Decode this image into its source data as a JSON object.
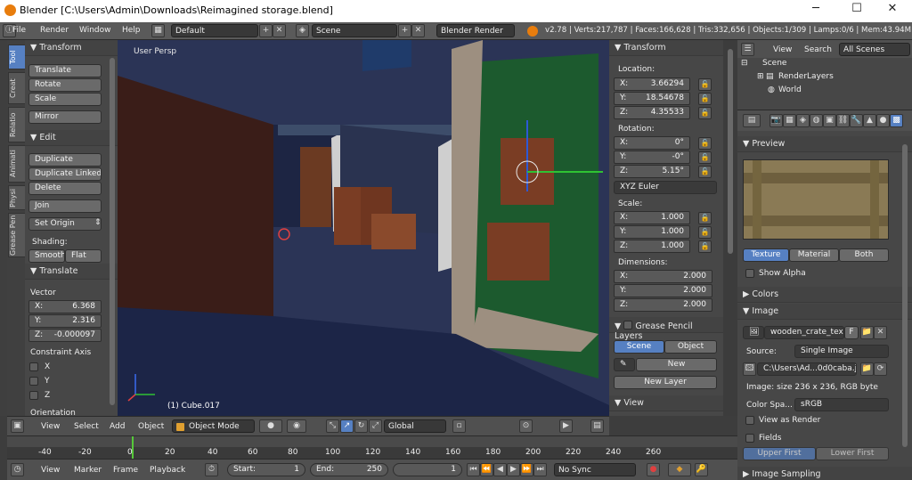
{
  "window": {
    "title": "Blender [C:\\Users\\Admin\\Downloads\\Reimagined storage.blend]",
    "min": "─",
    "max": "☐",
    "close": "✕"
  },
  "menu": {
    "items": [
      "File",
      "Render",
      "Window",
      "Help"
    ],
    "layout": "Default",
    "scene": "Scene",
    "engine": "Blender Render",
    "stats": "v2.78 | Verts:217,787 | Faces:166,628 | Tris:332,656 | Objects:1/309 | Lamps:0/6 | Mem:43.94M"
  },
  "tabs": [
    "Tool",
    "Creat",
    "Relatio",
    "Animati",
    "Physi",
    "Grease Pen"
  ],
  "tools": {
    "transform_title": "Transform",
    "translate": "Translate",
    "rotate": "Rotate",
    "scale": "Scale",
    "mirror": "Mirror",
    "edit_title": "Edit",
    "duplicate": "Duplicate",
    "duplicate_linked": "Duplicate Linked",
    "delete": "Delete",
    "join": "Join",
    "set_origin": "Set Origin",
    "shading": "Shading:",
    "smooth": "Smooth",
    "flat": "Flat"
  },
  "operator": {
    "title": "Translate",
    "vector": "Vector",
    "x_label": "X:",
    "x": "6.368",
    "y_label": "Y:",
    "y": "2.316",
    "z_label": "Z:",
    "z": "-0.000097",
    "constraint": "Constraint Axis",
    "cx": "X",
    "cy": "Y",
    "cz": "Z",
    "orientation": "Orientation"
  },
  "viewport": {
    "persp": "User Persp",
    "object": "(1) Cube.017",
    "toolbar": {
      "view": "View",
      "select": "Select",
      "add": "Add",
      "object": "Object",
      "mode": "Object Mode",
      "orientation": "Global"
    }
  },
  "npanel": {
    "transform": "Transform",
    "location": "Location:",
    "loc": [
      {
        "l": "X:",
        "v": "3.66294"
      },
      {
        "l": "Y:",
        "v": "18.54678"
      },
      {
        "l": "Z:",
        "v": "4.35533"
      }
    ],
    "rotation": "Rotation:",
    "rot": [
      {
        "l": "X:",
        "v": "0°"
      },
      {
        "l": "Y:",
        "v": "-0°"
      },
      {
        "l": "Z:",
        "v": "5.15°"
      }
    ],
    "euler": "XYZ Euler",
    "scale": "Scale:",
    "scl": [
      {
        "l": "X:",
        "v": "1.000"
      },
      {
        "l": "Y:",
        "v": "1.000"
      },
      {
        "l": "Z:",
        "v": "1.000"
      }
    ],
    "dimensions": "Dimensions:",
    "dim": [
      {
        "l": "X:",
        "v": "2.000"
      },
      {
        "l": "Y:",
        "v": "2.000"
      },
      {
        "l": "Z:",
        "v": "2.000"
      }
    ],
    "gp": "Grease Pencil Layers",
    "gp_scene": "Scene",
    "gp_object": "Object",
    "gp_new": "New",
    "gp_new_layer": "New Layer",
    "view": "View"
  },
  "outliner": {
    "view": "View",
    "search": "Search",
    "all": "All Scenes",
    "scene": "Scene",
    "render_layers": "RenderLayers",
    "world": "World"
  },
  "props": {
    "preview": "Preview",
    "texture": "Texture",
    "material": "Material",
    "both": "Both",
    "show_alpha": "Show Alpha",
    "colors": "Colors",
    "image": "Image",
    "image_name": "wooden_crate_tex...",
    "f": "F",
    "source_label": "Source:",
    "source": "Single Image",
    "path": "C:\\Users\\Ad...0d0caba.jpg",
    "size": "Image: size 236 x 236, RGB byte",
    "color_space_label": "Color Spa...",
    "color_space": "sRGB",
    "view_as_render": "View as Render",
    "fields": "Fields",
    "upper": "Upper First",
    "lower": "Lower First",
    "image_sampling": "Image Sampling"
  },
  "timeline": {
    "ticks": [
      "-40",
      "-20",
      "0",
      "20",
      "40",
      "60",
      "80",
      "100",
      "120",
      "140",
      "160",
      "180",
      "200",
      "220",
      "240",
      "260"
    ],
    "view": "View",
    "marker": "Marker",
    "frame": "Frame",
    "playback": "Playback",
    "start_label": "Start:",
    "start": "1",
    "end_label": "End:",
    "end": "250",
    "current": "1",
    "sync": "No Sync"
  }
}
